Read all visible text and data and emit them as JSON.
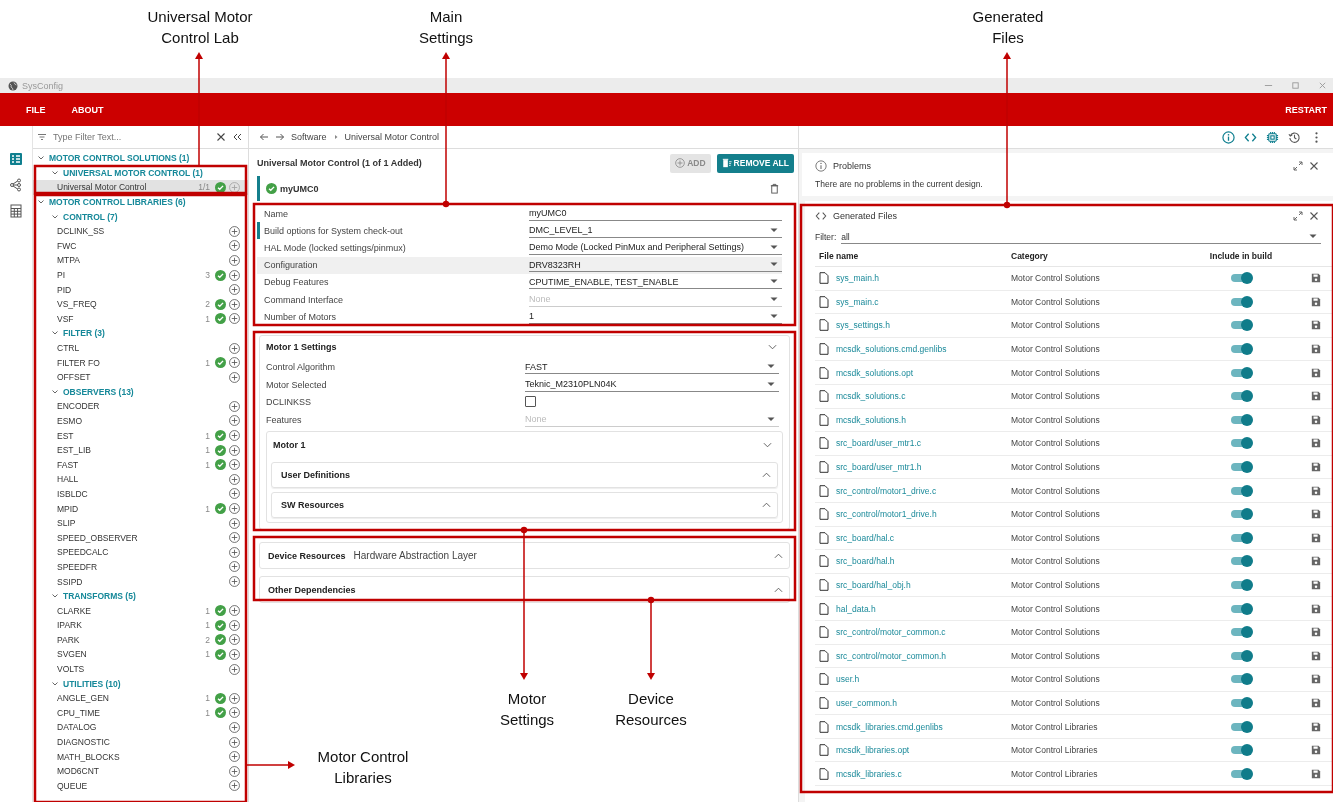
{
  "window": {
    "title": "SysConfig"
  },
  "menu": [
    {
      "label": "FILE"
    },
    {
      "label": "ABOUT"
    }
  ],
  "restart": "RESTART",
  "filter": {
    "placeholder": "Type Filter Text..."
  },
  "tree": [
    {
      "label": "MOTOR CONTROL SOLUTIONS (1)",
      "expanded": true,
      "children": [
        {
          "label": "UNIVERSAL MOTOR CONTROL (1)",
          "expanded": true,
          "children": [
            {
              "label": "Universal Motor Control",
              "count": "1/1",
              "added": true,
              "selected": true
            }
          ]
        }
      ]
    },
    {
      "label": "MOTOR CONTROL LIBRARIES (6)",
      "expanded": true,
      "children": [
        {
          "label": "CONTROL (7)",
          "expanded": true,
          "children": [
            {
              "label": "DCLINK_SS",
              "added": false,
              "selected": false
            },
            {
              "label": "FWC",
              "added": false,
              "selected": false
            },
            {
              "label": "MTPA",
              "added": false,
              "selected": false
            },
            {
              "label": "PI",
              "count": "3",
              "added": true,
              "selected": false
            },
            {
              "label": "PID",
              "added": false,
              "selected": false
            },
            {
              "label": "VS_FREQ",
              "count": "2",
              "added": true,
              "selected": false
            },
            {
              "label": "VSF",
              "count": "1",
              "added": true,
              "selected": false
            }
          ]
        },
        {
          "label": "FILTER (3)",
          "expanded": true,
          "children": [
            {
              "label": "CTRL",
              "added": false,
              "selected": false
            },
            {
              "label": "FILTER FO",
              "count": "1",
              "added": true,
              "selected": false
            },
            {
              "label": "OFFSET",
              "added": false,
              "selected": false
            }
          ]
        },
        {
          "label": "OBSERVERS (13)",
          "expanded": true,
          "children": [
            {
              "label": "ENCODER",
              "added": false,
              "selected": false
            },
            {
              "label": "ESMO",
              "added": false,
              "selected": false
            },
            {
              "label": "EST",
              "count": "1",
              "added": true,
              "selected": false
            },
            {
              "label": "EST_LIB",
              "count": "1",
              "added": true,
              "selected": false
            },
            {
              "label": "FAST",
              "count": "1",
              "added": true,
              "selected": false
            },
            {
              "label": "HALL",
              "added": false,
              "selected": false
            },
            {
              "label": "ISBLDC",
              "added": false,
              "selected": false
            },
            {
              "label": "MPID",
              "count": "1",
              "added": true,
              "selected": false
            },
            {
              "label": "SLIP",
              "added": false,
              "selected": false
            },
            {
              "label": "SPEED_OBSERVER",
              "added": false,
              "selected": false
            },
            {
              "label": "SPEEDCALC",
              "added": false,
              "selected": false
            },
            {
              "label": "SPEEDFR",
              "added": false,
              "selected": false
            },
            {
              "label": "SSIPD",
              "added": false,
              "selected": false
            }
          ]
        },
        {
          "label": "TRANSFORMS (5)",
          "expanded": true,
          "children": [
            {
              "label": "CLARKE",
              "count": "1",
              "added": true,
              "selected": false
            },
            {
              "label": "IPARK",
              "count": "1",
              "added": true,
              "selected": false
            },
            {
              "label": "PARK",
              "count": "2",
              "added": true,
              "selected": false
            },
            {
              "label": "SVGEN",
              "count": "1",
              "added": true,
              "selected": false
            },
            {
              "label": "VOLTS",
              "added": false,
              "selected": false
            }
          ]
        },
        {
          "label": "UTILITIES (10)",
          "expanded": true,
          "children": [
            {
              "label": "ANGLE_GEN",
              "count": "1",
              "added": true,
              "selected": false
            },
            {
              "label": "CPU_TIME",
              "count": "1",
              "added": true,
              "selected": false
            },
            {
              "label": "DATALOG",
              "added": false,
              "selected": false
            },
            {
              "label": "DIAGNOSTIC",
              "added": false,
              "selected": false
            },
            {
              "label": "MATH_BLOCKS",
              "added": false,
              "selected": false
            },
            {
              "label": "MOD6CNT",
              "added": false,
              "selected": false
            },
            {
              "label": "QUEUE",
              "added": false,
              "selected": false
            }
          ]
        }
      ]
    }
  ],
  "breadcrumb": [
    "Software",
    "Universal Motor Control"
  ],
  "component": {
    "title": "Universal Motor Control (1 of 1 Added)",
    "add_button": {
      "label": "ADD",
      "disabled": true
    },
    "remove_button": "REMOVE ALL",
    "instance": {
      "name": "myUMC0",
      "valid": true
    }
  },
  "settings": [
    {
      "label": "Name",
      "value": "myUMC0",
      "kind": "text",
      "modified": false,
      "highlighted": false,
      "disabled": false
    },
    {
      "label": "Build options for System check-out",
      "value": "DMC_LEVEL_1",
      "kind": "select",
      "modified": true,
      "highlighted": false,
      "disabled": false
    },
    {
      "label": "HAL Mode (locked settings/pinmux)",
      "value": "Demo Mode (Locked PinMux and Peripheral Settings)",
      "kind": "select",
      "modified": false,
      "highlighted": false,
      "disabled": false
    },
    {
      "label": "Configuration",
      "value": "DRV8323RH",
      "kind": "select",
      "modified": false,
      "highlighted": true,
      "disabled": false
    },
    {
      "label": "Debug Features",
      "value": "CPUTIME_ENABLE, TEST_ENABLE",
      "kind": "select",
      "modified": false,
      "highlighted": false,
      "disabled": false
    },
    {
      "label": "Command Interface",
      "value": "None",
      "kind": "select",
      "modified": false,
      "highlighted": false,
      "disabled": true
    },
    {
      "label": "Number of Motors",
      "value": "1",
      "kind": "select",
      "modified": false,
      "highlighted": false,
      "disabled": false
    }
  ],
  "motor_settings": {
    "title": "Motor 1 Settings",
    "expanded": true,
    "rows": [
      {
        "label": "Control Algorithm",
        "value": "FAST",
        "kind": "select",
        "disabled": false
      },
      {
        "label": "Motor Selected",
        "value": "Teknic_M2310PLN04K",
        "kind": "select",
        "disabled": false
      },
      {
        "label": "DCLINKSS",
        "kind": "checkbox",
        "checked": false
      },
      {
        "label": "Features",
        "value": "None",
        "kind": "select",
        "disabled": true
      }
    ],
    "section": {
      "title": "Motor 1",
      "expanded": true,
      "children": [
        {
          "title": "User Definitions",
          "expanded": false
        },
        {
          "title": "SW Resources",
          "expanded": false
        }
      ]
    }
  },
  "device_sections": [
    {
      "title": "Device Resources",
      "subtitle": "Hardware Abstraction Layer",
      "expanded": false
    },
    {
      "title": "Other Dependencies",
      "expanded": false
    }
  ],
  "problems": {
    "title": "Problems",
    "message": "There are no problems in the current design."
  },
  "generated_files": {
    "title": "Generated Files",
    "filter_label": "Filter:",
    "filter_value": "all",
    "columns": [
      "File name",
      "Category",
      "Include in build"
    ],
    "rows": [
      {
        "name": "sys_main.h",
        "category": "Motor Control Solutions",
        "included": true
      },
      {
        "name": "sys_main.c",
        "category": "Motor Control Solutions",
        "included": true
      },
      {
        "name": "sys_settings.h",
        "category": "Motor Control Solutions",
        "included": true
      },
      {
        "name": "mcsdk_solutions.cmd.genlibs",
        "category": "Motor Control Solutions",
        "included": true
      },
      {
        "name": "mcsdk_solutions.opt",
        "category": "Motor Control Solutions",
        "included": true
      },
      {
        "name": "mcsdk_solutions.c",
        "category": "Motor Control Solutions",
        "included": true
      },
      {
        "name": "mcsdk_solutions.h",
        "category": "Motor Control Solutions",
        "included": true
      },
      {
        "name": "src_board/user_mtr1.c",
        "category": "Motor Control Solutions",
        "included": true
      },
      {
        "name": "src_board/user_mtr1.h",
        "category": "Motor Control Solutions",
        "included": true
      },
      {
        "name": "src_control/motor1_drive.c",
        "category": "Motor Control Solutions",
        "included": true
      },
      {
        "name": "src_control/motor1_drive.h",
        "category": "Motor Control Solutions",
        "included": true
      },
      {
        "name": "src_board/hal.c",
        "category": "Motor Control Solutions",
        "included": true
      },
      {
        "name": "src_board/hal.h",
        "category": "Motor Control Solutions",
        "included": true
      },
      {
        "name": "src_board/hal_obj.h",
        "category": "Motor Control Solutions",
        "included": true
      },
      {
        "name": "hal_data.h",
        "category": "Motor Control Solutions",
        "included": true
      },
      {
        "name": "src_control/motor_common.c",
        "category": "Motor Control Solutions",
        "included": true
      },
      {
        "name": "src_control/motor_common.h",
        "category": "Motor Control Solutions",
        "included": true
      },
      {
        "name": "user.h",
        "category": "Motor Control Solutions",
        "included": true
      },
      {
        "name": "user_common.h",
        "category": "Motor Control Solutions",
        "included": true
      },
      {
        "name": "mcsdk_libraries.cmd.genlibs",
        "category": "Motor Control Libraries",
        "included": true
      },
      {
        "name": "mcsdk_libraries.opt",
        "category": "Motor Control Libraries",
        "included": true
      },
      {
        "name": "mcsdk_libraries.c",
        "category": "Motor Control Libraries",
        "included": true
      }
    ]
  },
  "annotations": [
    {
      "lines": [
        "Universal Motor",
        "Control Lab"
      ]
    },
    {
      "lines": [
        "Main",
        "Settings"
      ]
    },
    {
      "lines": [
        "Generated",
        "Files"
      ]
    },
    {
      "lines": [
        "Motor",
        "Settings"
      ]
    },
    {
      "lines": [
        "Device",
        "Resources"
      ]
    },
    {
      "lines": [
        "Motor Control",
        "Libraries"
      ]
    }
  ]
}
